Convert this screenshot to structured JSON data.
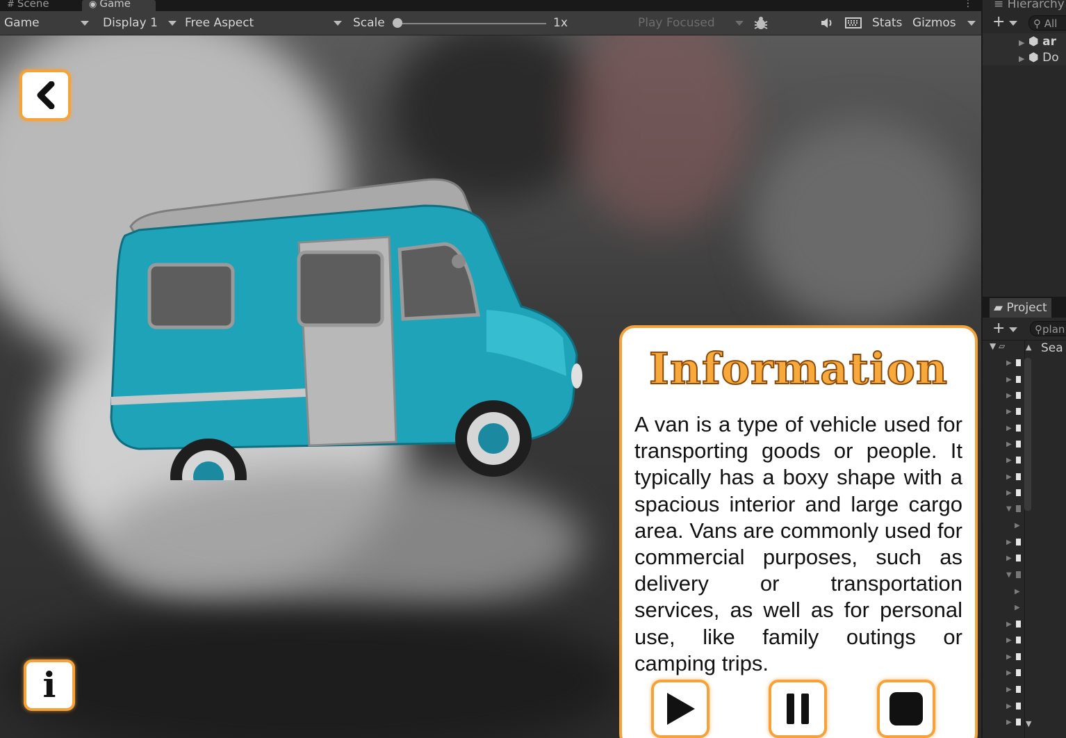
{
  "tabs": {
    "scene": "Scene",
    "game": "Game"
  },
  "toolbar": {
    "game_dropdown": "Game",
    "display": "Display 1",
    "aspect": "Free Aspect",
    "scale_label": "Scale",
    "scale_value": "1x",
    "play_focused": "Play Focused",
    "stats": "Stats",
    "gizmos": "Gizmos"
  },
  "info_panel": {
    "title": "Information",
    "body": "A van is a type of vehicle used for transporting goods or people. It typically has a boxy shape with a spacious interior and large cargo area. Vans are commonly used for commercial purposes, such as delivery or transportation services, as well as for personal use, like family outings or camping trips."
  },
  "ar_buttons": {
    "info": "i"
  },
  "hierarchy": {
    "title": "Hierarchy",
    "search": "All",
    "items": [
      "ar",
      "Do"
    ]
  },
  "project": {
    "title": "Project",
    "search": "plan",
    "search_header": "Sea"
  },
  "colors": {
    "accent_orange": "#f5a23a",
    "van_teal": "#1fa3b8",
    "editor_bg": "#3c3c3c"
  }
}
